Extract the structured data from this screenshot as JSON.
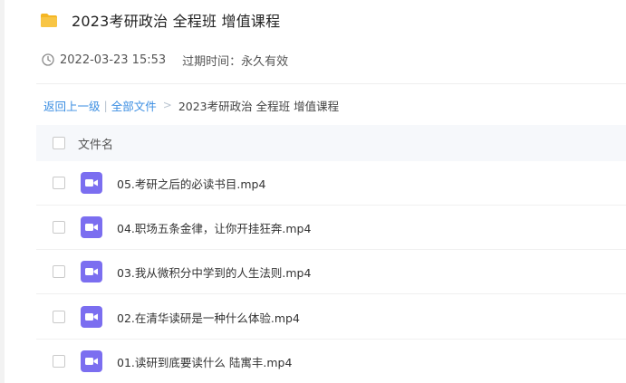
{
  "header": {
    "title": "2023考研政治 全程班 增值课程",
    "folder_icon": "folder-icon",
    "folder_color": "#f5b623"
  },
  "meta": {
    "clock_icon": "clock-icon",
    "date": "2022-03-23 15:53",
    "expiry": "过期时间：永久有效"
  },
  "breadcrumb": {
    "back": "返回上一级",
    "separator": "|",
    "all_files": "全部文件",
    "arrow": ">",
    "current": "2023考研政治 全程班 增值课程"
  },
  "table": {
    "column_header": "文件名",
    "file_icon": "video-file-icon",
    "icon_color": "#7b6ef0",
    "rows": [
      {
        "name": "05.考研之后的必读书目.mp4"
      },
      {
        "name": "04.职场五条金律，让你开挂狂奔.mp4"
      },
      {
        "name": "03.我从微积分中学到的人生法则.mp4"
      },
      {
        "name": "02.在清华读研是一种什么体验.mp4"
      },
      {
        "name": "01.读研到底要读什么 陆寓丰.mp4"
      }
    ]
  },
  "colors": {
    "link": "#3b8ee2",
    "header_bg": "#f6f8fb"
  }
}
